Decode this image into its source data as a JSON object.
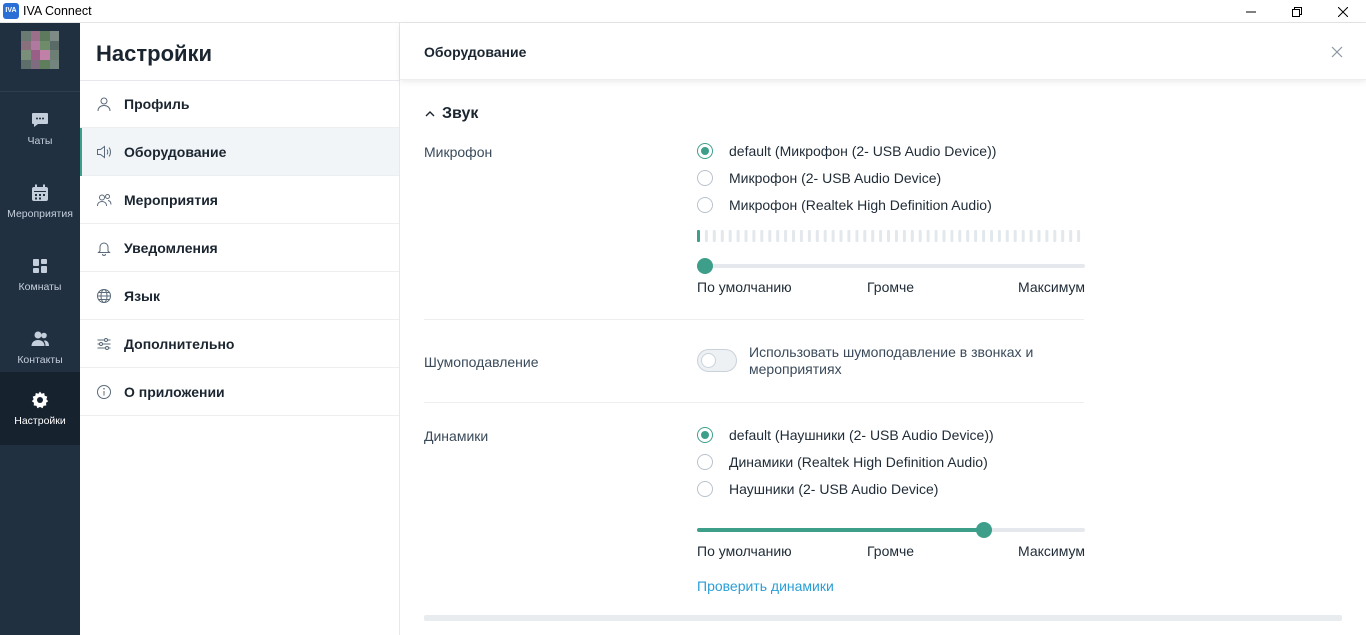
{
  "window": {
    "app_logo": "IVA",
    "title": "IVA Connect"
  },
  "rail": {
    "items": [
      {
        "label": "Чаты",
        "icon": "chat-icon"
      },
      {
        "label": "Мероприятия",
        "icon": "calendar-icon"
      },
      {
        "label": "Комнаты",
        "icon": "rooms-icon"
      },
      {
        "label": "Контакты",
        "icon": "contacts-icon"
      },
      {
        "label": "Настройки",
        "icon": "gear-icon",
        "active": true
      }
    ]
  },
  "menu": {
    "title": "Настройки",
    "items": [
      {
        "label": "Профиль",
        "icon": "user-icon"
      },
      {
        "label": "Оборудование",
        "icon": "speaker-icon",
        "active": true
      },
      {
        "label": "Мероприятия",
        "icon": "people-icon"
      },
      {
        "label": "Уведомления",
        "icon": "bell-icon"
      },
      {
        "label": "Язык",
        "icon": "globe-icon"
      },
      {
        "label": "Дополнительно",
        "icon": "sliders-icon"
      },
      {
        "label": "О приложении",
        "icon": "info-icon"
      }
    ]
  },
  "main": {
    "title": "Оборудование",
    "section": "Звук",
    "microphone": {
      "label": "Микрофон",
      "options": [
        "default (Микрофон (2- USB Audio Device))",
        "Микрофон (2- USB Audio Device)",
        "Микрофон (Realtek High Definition Audio)"
      ],
      "selected": 0,
      "level_fraction": 0.02,
      "volume_fraction": 0.02
    },
    "noise": {
      "label": "Шумоподавление",
      "toggle_text": "Использовать шумоподавление в звонках и мероприятиях",
      "enabled": false
    },
    "speakers": {
      "label": "Динамики",
      "options": [
        "default (Наушники (2- USB Audio Device))",
        "Динамики (Realtek High Definition Audio)",
        "Наушники (2- USB Audio Device)"
      ],
      "selected": 0,
      "volume_fraction": 0.74,
      "test_link": "Проверить динамики"
    },
    "scale": {
      "min": "По умолчанию",
      "mid": "Громче",
      "max": "Максимум"
    }
  },
  "colors": {
    "accent": "#3d9f8a",
    "rail_bg": "#213041",
    "link": "#2a9fd6"
  }
}
